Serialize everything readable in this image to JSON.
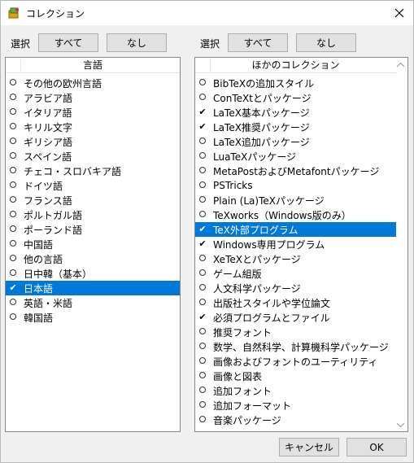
{
  "window": {
    "title": "コレクション"
  },
  "left": {
    "select_label": "選択",
    "all_button": "すべて",
    "none_button": "なし",
    "header": "言語",
    "items": [
      {
        "label": "その他の欧州言語",
        "checked": false,
        "selected": false
      },
      {
        "label": "アラビア語",
        "checked": false,
        "selected": false
      },
      {
        "label": "イタリア語",
        "checked": false,
        "selected": false
      },
      {
        "label": "キリル文字",
        "checked": false,
        "selected": false
      },
      {
        "label": "ギリシア語",
        "checked": false,
        "selected": false
      },
      {
        "label": "スペイン語",
        "checked": false,
        "selected": false
      },
      {
        "label": "チェコ・スロバキア語",
        "checked": false,
        "selected": false
      },
      {
        "label": "ドイツ語",
        "checked": false,
        "selected": false
      },
      {
        "label": "フランス語",
        "checked": false,
        "selected": false
      },
      {
        "label": "ポルトガル語",
        "checked": false,
        "selected": false
      },
      {
        "label": "ポーランド語",
        "checked": false,
        "selected": false
      },
      {
        "label": "中国語",
        "checked": false,
        "selected": false
      },
      {
        "label": "他の言語",
        "checked": false,
        "selected": false
      },
      {
        "label": "日中韓（基本）",
        "checked": false,
        "selected": false
      },
      {
        "label": "日本語",
        "checked": true,
        "selected": true
      },
      {
        "label": "英語・米語",
        "checked": false,
        "selected": false
      },
      {
        "label": "韓国語",
        "checked": false,
        "selected": false
      }
    ]
  },
  "right": {
    "select_label": "選択",
    "all_button": "すべて",
    "none_button": "なし",
    "header": "ほかのコレクション",
    "items": [
      {
        "label": "BibTeXの追加スタイル",
        "checked": false,
        "selected": false
      },
      {
        "label": "ConTeXtとパッケージ",
        "checked": false,
        "selected": false
      },
      {
        "label": "LaTeX基本パッケージ",
        "checked": true,
        "selected": false
      },
      {
        "label": "LaTeX推奨パッケージ",
        "checked": true,
        "selected": false
      },
      {
        "label": "LaTeX追加パッケージ",
        "checked": false,
        "selected": false
      },
      {
        "label": "LuaTeXパッケージ",
        "checked": false,
        "selected": false
      },
      {
        "label": "MetaPostおよびMetafontパッケージ",
        "checked": false,
        "selected": false
      },
      {
        "label": "PSTricks",
        "checked": false,
        "selected": false
      },
      {
        "label": "Plain (La)TeXパッケージ",
        "checked": false,
        "selected": false
      },
      {
        "label": "TeXworks（Windows版のみ）",
        "checked": false,
        "selected": false
      },
      {
        "label": "TeX外部プログラム",
        "checked": true,
        "selected": true
      },
      {
        "label": "Windows専用プログラム",
        "checked": true,
        "selected": false
      },
      {
        "label": "XeTeXとパッケージ",
        "checked": false,
        "selected": false
      },
      {
        "label": "ゲーム組版",
        "checked": false,
        "selected": false
      },
      {
        "label": "人文科学パッケージ",
        "checked": false,
        "selected": false
      },
      {
        "label": "出版社スタイルや学位論文",
        "checked": false,
        "selected": false
      },
      {
        "label": "必須プログラムとファイル",
        "checked": true,
        "selected": false
      },
      {
        "label": "推奨フォント",
        "checked": false,
        "selected": false
      },
      {
        "label": "数学、自然科学、計算機科学パッケージ",
        "checked": false,
        "selected": false
      },
      {
        "label": "画像およびフォントのユーティリティ",
        "checked": false,
        "selected": false
      },
      {
        "label": "画像と図表",
        "checked": false,
        "selected": false
      },
      {
        "label": "追加フォント",
        "checked": false,
        "selected": false
      },
      {
        "label": "追加フォーマット",
        "checked": false,
        "selected": false
      },
      {
        "label": "音楽パッケージ",
        "checked": false,
        "selected": false
      }
    ]
  },
  "footer": {
    "cancel_button": "キャンセル",
    "ok_button": "OK"
  },
  "colors": {
    "selection": "#0078d7",
    "face": "#f0f0f0"
  }
}
